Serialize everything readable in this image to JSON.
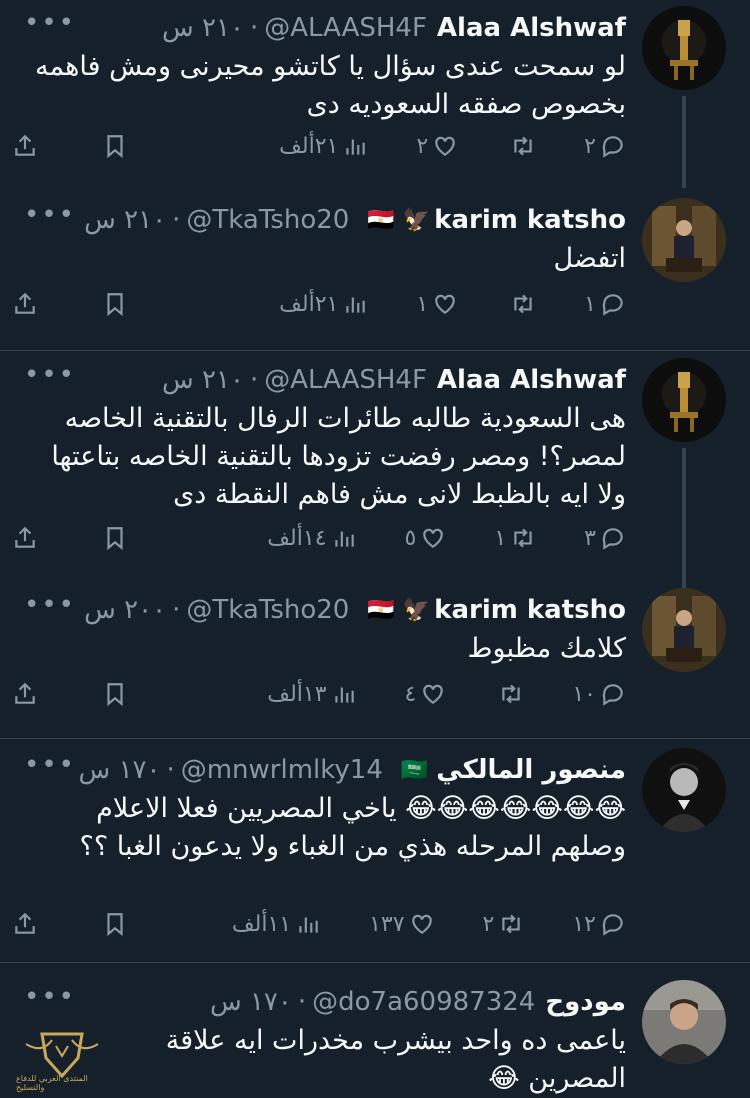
{
  "tweets": [
    {
      "name": "Alaa Alshwaf",
      "handle": "@ALAASH4F",
      "time": "٢١٠ س",
      "flag": "",
      "text": "لو سمحت عندى سؤال يا كاتشو محيرنى ومش فاهمه بخصوص صفقه السعوديه دى",
      "replies": "٢",
      "retweets": "",
      "likes": "٢",
      "views": "٢١ألف",
      "avatar": "pharaoh"
    },
    {
      "name": "karim katsho",
      "handle": "@TkaTsho20",
      "time": "٢١٠ س",
      "flag": "🇪🇬",
      "text": "اتفضل",
      "replies": "١",
      "retweets": "",
      "likes": "١",
      "views": "٢١ألف",
      "avatar": "man-chair"
    },
    {
      "name": "Alaa Alshwaf",
      "handle": "@ALAASH4F",
      "time": "٢١٠ س",
      "flag": "",
      "text": "هى السعودية طالبه طائرات الرفال بالتقنية الخاصه لمصر؟! ومصر رفضت تزودها بالتقنية الخاصه بتاعتها ولا ايه بالظبط لانى مش فاهم النقطة دى",
      "replies": "٣",
      "retweets": "١",
      "likes": "٥",
      "views": "١٤ألف",
      "avatar": "pharaoh"
    },
    {
      "name": "karim katsho",
      "handle": "@TkaTsho20",
      "time": "٢٠٠ س",
      "flag": "🇪🇬",
      "text": "كلامك مظبوط",
      "replies": "١٠",
      "retweets": "",
      "likes": "٤",
      "views": "١٣ألف",
      "avatar": "man-chair"
    },
    {
      "name": "منصور المالكي",
      "handle": "@mnwrlmlky14",
      "time": "١٧٠ س",
      "flag": "🇸🇦",
      "text": "😂😂😂😂😂😂😂 ياخي المصريين فعلا الاعلام وصلهم المرحله هذي من الغباء ولا يدعون الغبا ؟؟",
      "replies": "١٢",
      "retweets": "٢",
      "likes": "١٣٧",
      "views": "١١ألف",
      "avatar": "bw-portrait"
    },
    {
      "name": "مودوح",
      "handle": "@do7a60987324",
      "time": "١٧٠ س",
      "flag": "",
      "text": "ياعمى ده واحد بيشرب مخدرات ايه علاقة المصرين 😂",
      "replies": "",
      "retweets": "",
      "likes": "",
      "views": "",
      "avatar": "young-man"
    }
  ],
  "more_label": "•••",
  "watermark_text": "المنتدى العربي للدفاع والتسليح",
  "colors": {
    "bg": "#15202b",
    "text": "#f7f9f9",
    "muted": "#8b98a5",
    "divider": "#38444d"
  }
}
